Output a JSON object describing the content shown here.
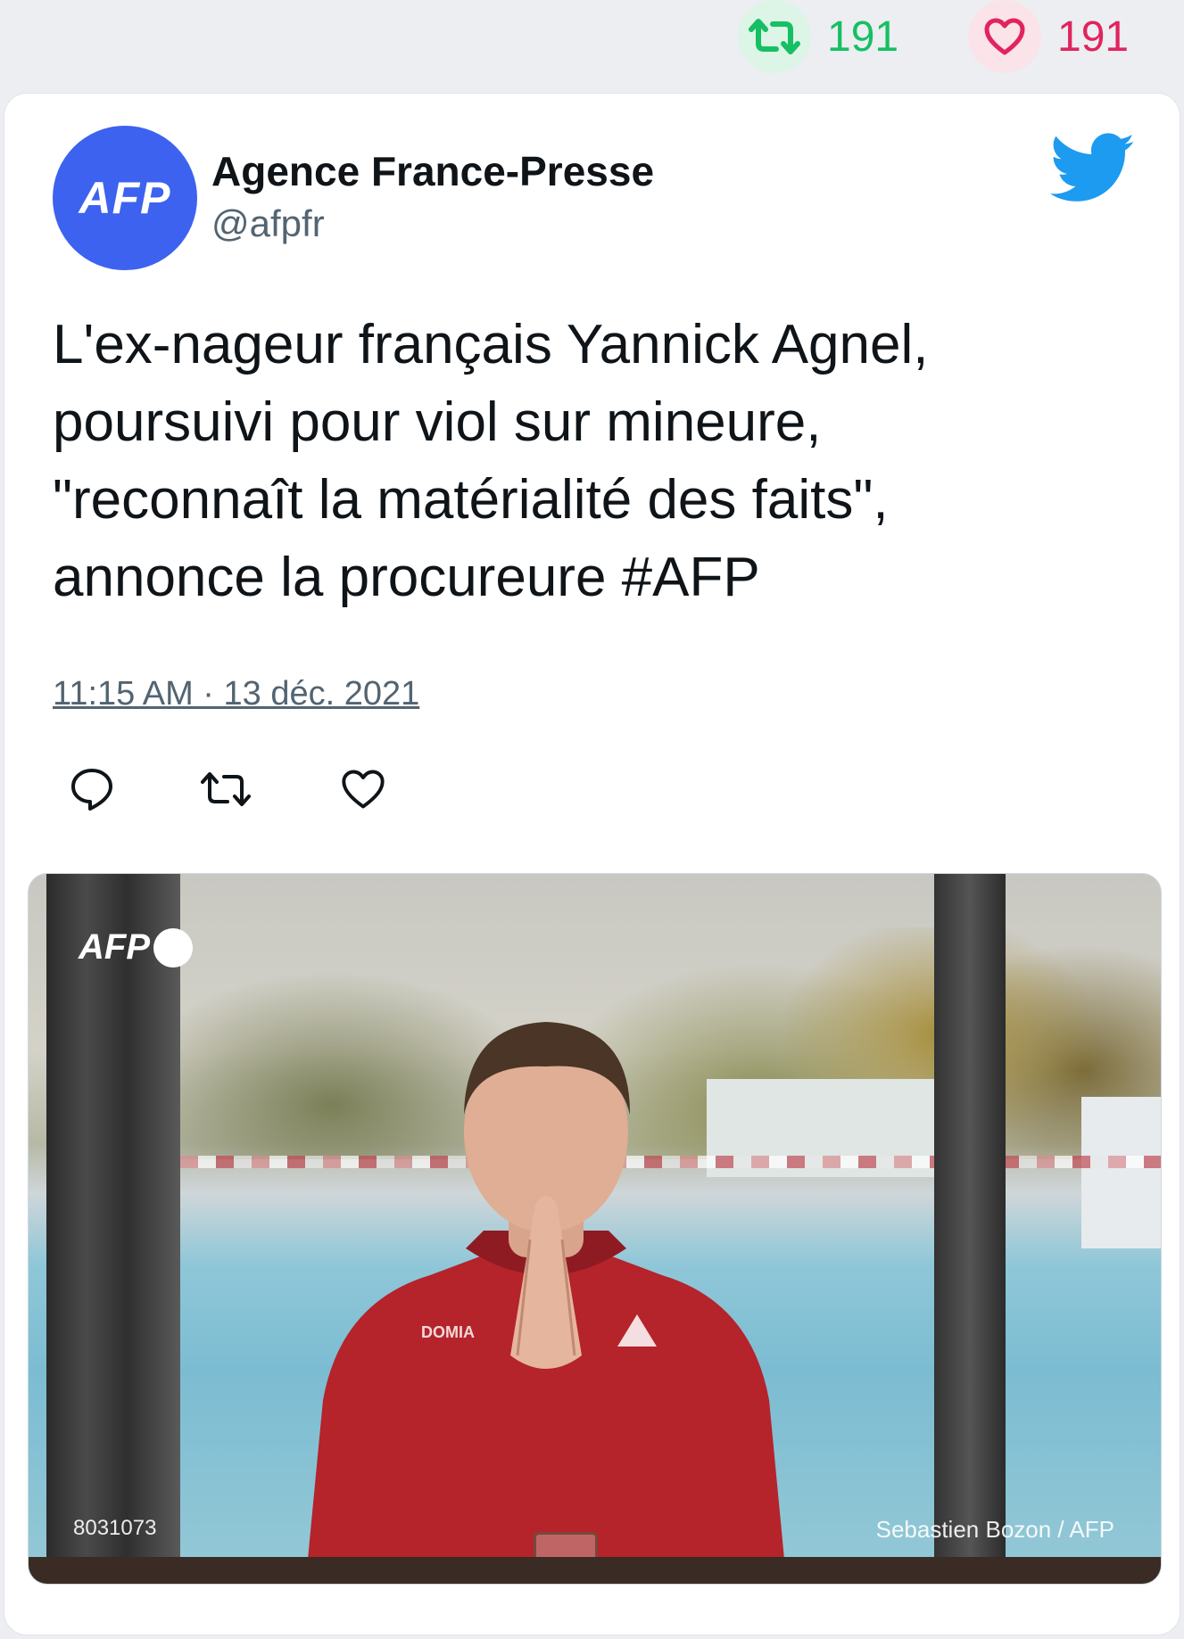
{
  "top_stats": {
    "retweet_count": "191",
    "like_count": "191",
    "retweet_color": "#17bf63",
    "like_color": "#e0245e",
    "retweet_icon": "retweet-icon",
    "like_icon": "heart-icon"
  },
  "tweet": {
    "author_name": "Agence France-Presse",
    "author_handle": "@afpfr",
    "avatar_text": "AFP",
    "avatar_color": "#3d62f0",
    "brand_icon": "twitter-bird-icon",
    "brand_color": "#1d9bf0",
    "text_lines": [
      "L'ex-nageur français Yannick Agnel,",
      "poursuivi pour viol sur mineure,",
      "\"reconnaît la matérialité des faits\",",
      "annonce la procureure #AFP"
    ],
    "timestamp": "11:15 AM · 13 déc. 2021",
    "actions": [
      {
        "name": "reply",
        "icon": "reply-icon"
      },
      {
        "name": "retweet",
        "icon": "retweet-icon"
      },
      {
        "name": "like",
        "icon": "heart-icon"
      }
    ]
  },
  "media": {
    "watermark": "AFP",
    "photo_id": "8031073",
    "credit": "Sebastien Bozon / AFP"
  }
}
